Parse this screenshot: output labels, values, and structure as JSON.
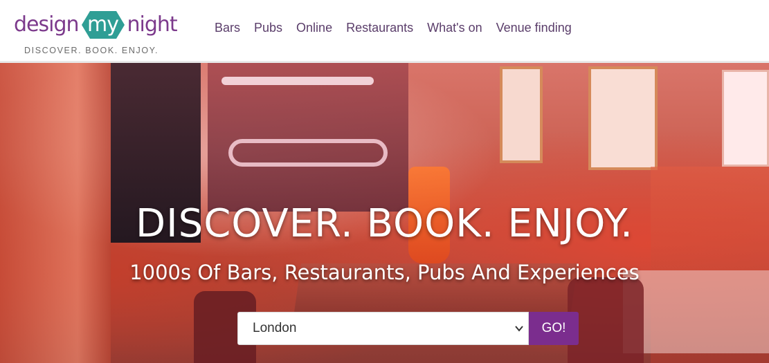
{
  "brand": {
    "logo_part1": "design",
    "logo_part2": "my",
    "logo_part3": "night",
    "tagline": "DISCOVER. BOOK. ENJOY.",
    "colors": {
      "purple": "#7c3a8c",
      "teal": "#2f9e95",
      "go_button": "#7b2d8e"
    }
  },
  "nav": {
    "items": [
      {
        "label": "Bars"
      },
      {
        "label": "Pubs"
      },
      {
        "label": "Online"
      },
      {
        "label": "Restaurants"
      },
      {
        "label": "What's on"
      },
      {
        "label": "Venue finding"
      }
    ]
  },
  "hero": {
    "title": "DISCOVER. BOOK. ENJOY.",
    "subtitle": "1000s Of Bars, Restaurants, Pubs And Experiences",
    "search": {
      "selected_city": "London",
      "go_label": "GO!"
    }
  },
  "icons": {
    "dropdown": "chevron-down-icon",
    "logo_badge": "hexagon-icon"
  }
}
